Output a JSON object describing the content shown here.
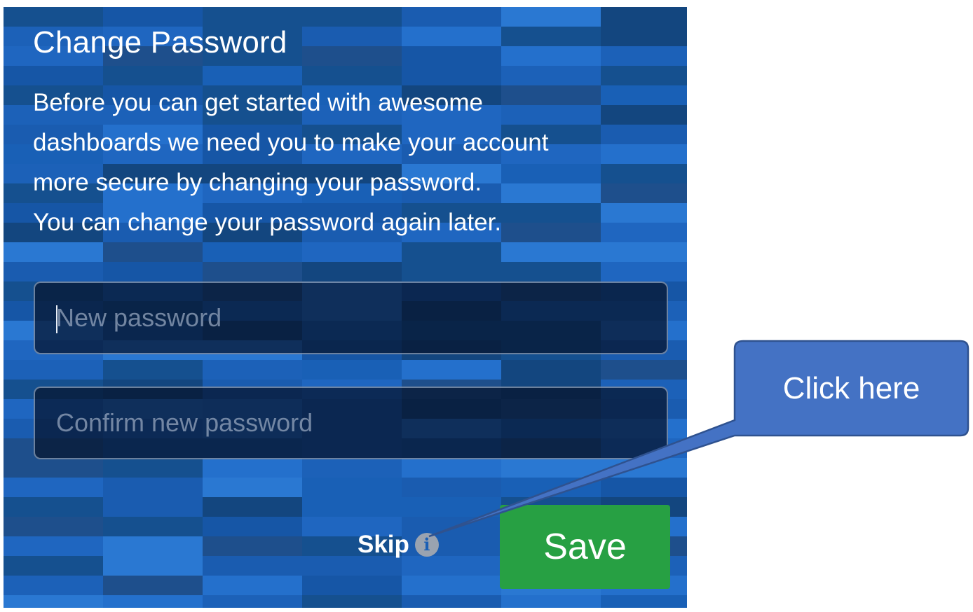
{
  "dialog": {
    "title": "Change Password",
    "description_lines": [
      "Before you can get started with awesome",
      "dashboards we need you to make your account",
      "more secure by changing your password.",
      "You can change your password again later."
    ],
    "new_password": {
      "value": "",
      "placeholder": "New password"
    },
    "confirm_password": {
      "value": "",
      "placeholder": "Confirm new password"
    },
    "skip_label": "Skip",
    "skip_icon": "info-icon",
    "save_label": "Save",
    "colors": {
      "background": "#1b5fb5",
      "save_button": "#27a043"
    }
  },
  "callout": {
    "text": "Click here",
    "color": "#4472c4"
  }
}
